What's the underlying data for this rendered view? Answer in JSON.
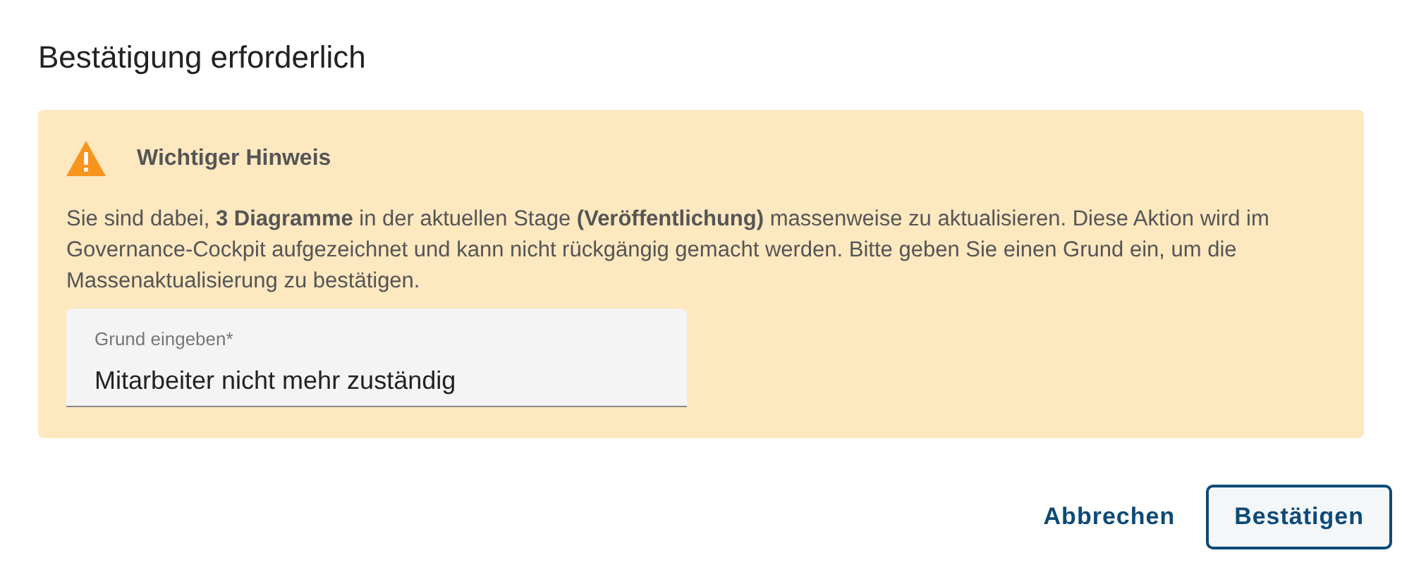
{
  "dialog": {
    "title": "Bestätigung erforderlich"
  },
  "notice": {
    "heading": "Wichtiger Hinweis",
    "text": "Sie sind dabei, **3 Diagramme** in der aktuellen Stage **(Veröffentlichung)** massenweise zu aktualisieren. Diese Aktion wird im Governance-Cockpit aufgezeichnet und kann nicht rückgängig gemacht werden. Bitte geben Sie einen Grund ein, um die Massenaktualisierung zu bestätigen."
  },
  "reason_field": {
    "label": "Grund eingeben*",
    "value": "Mitarbeiter nicht mehr zuständig"
  },
  "buttons": [
    {
      "label": "Abbrechen",
      "kind": "text"
    },
    {
      "label": "Bestätigen",
      "kind": "outlined"
    }
  ]
}
